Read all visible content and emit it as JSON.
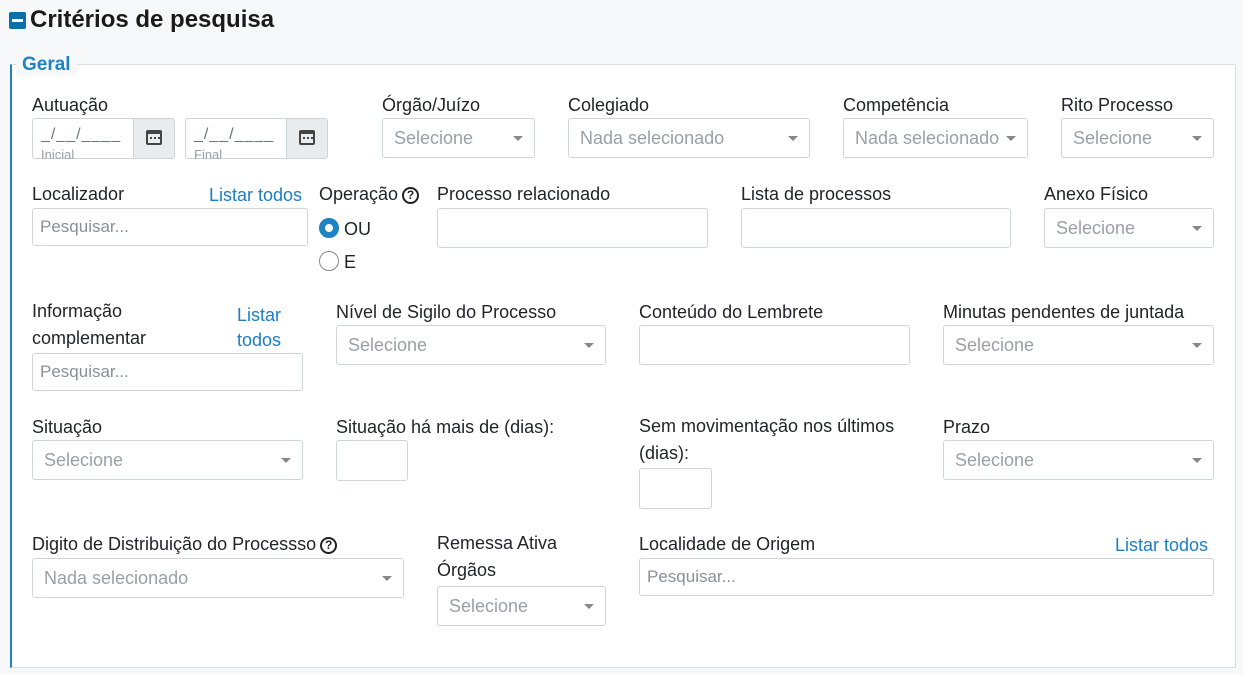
{
  "header": {
    "title": "Critérios de pesquisa",
    "toggle_icon": "minus-square-icon"
  },
  "section": {
    "legend": "Geral"
  },
  "autuacao": {
    "label": "Autuação",
    "start": {
      "mask": "_/__/____",
      "sub": "Inicial"
    },
    "end": {
      "mask": "_/__/____",
      "sub": "Final"
    }
  },
  "orgao_juizo": {
    "label": "Órgão/Juízo",
    "value": "Selecione"
  },
  "colegiado": {
    "label": "Colegiado",
    "value": "Nada selecionado"
  },
  "competencia": {
    "label": "Competência",
    "value": "Nada selecionado"
  },
  "rito_processo": {
    "label": "Rito Processo",
    "value": "Selecione"
  },
  "localizador": {
    "label": "Localizador",
    "link": "Listar todos",
    "placeholder": "Pesquisar..."
  },
  "operacao": {
    "label": "Operação",
    "options": [
      "OU",
      "E"
    ],
    "selected": "OU"
  },
  "processo_relacionado": {
    "label": "Processo relacionado",
    "value": ""
  },
  "lista_processos": {
    "label": "Lista de processos",
    "value": ""
  },
  "anexo_fisico": {
    "label": "Anexo Físico",
    "value": "Selecione"
  },
  "informacao_complementar": {
    "label": "Informação complementar",
    "link": "Listar todos",
    "placeholder": "Pesquisar..."
  },
  "nivel_sigilo": {
    "label": "Nível de Sigilo do Processo",
    "value": "Selecione"
  },
  "conteudo_lembrete": {
    "label": "Conteúdo do Lembrete",
    "value": ""
  },
  "minutas_pendentes": {
    "label": "Minutas pendentes de juntada",
    "value": "Selecione"
  },
  "situacao": {
    "label": "Situação",
    "value": "Selecione"
  },
  "situacao_dias": {
    "label": "Situação há mais de (dias):",
    "value": ""
  },
  "sem_movimentacao": {
    "label": "Sem movimentação nos últimos (dias):",
    "value": ""
  },
  "prazo": {
    "label": "Prazo",
    "value": "Selecione"
  },
  "digito_distribuicao": {
    "label": "Digito de Distribuição do Processso",
    "value": "Nada selecionado"
  },
  "remessa_ativa": {
    "label": "Remessa Ativa Órgãos",
    "value": "Selecione"
  },
  "localidade_origem": {
    "label": "Localidade de Origem",
    "link": "Listar todos",
    "placeholder": "Pesquisar..."
  },
  "colors": {
    "accent": "#1d83c2",
    "toggle": "#0d6eaa",
    "link": "#1d7dc4"
  }
}
